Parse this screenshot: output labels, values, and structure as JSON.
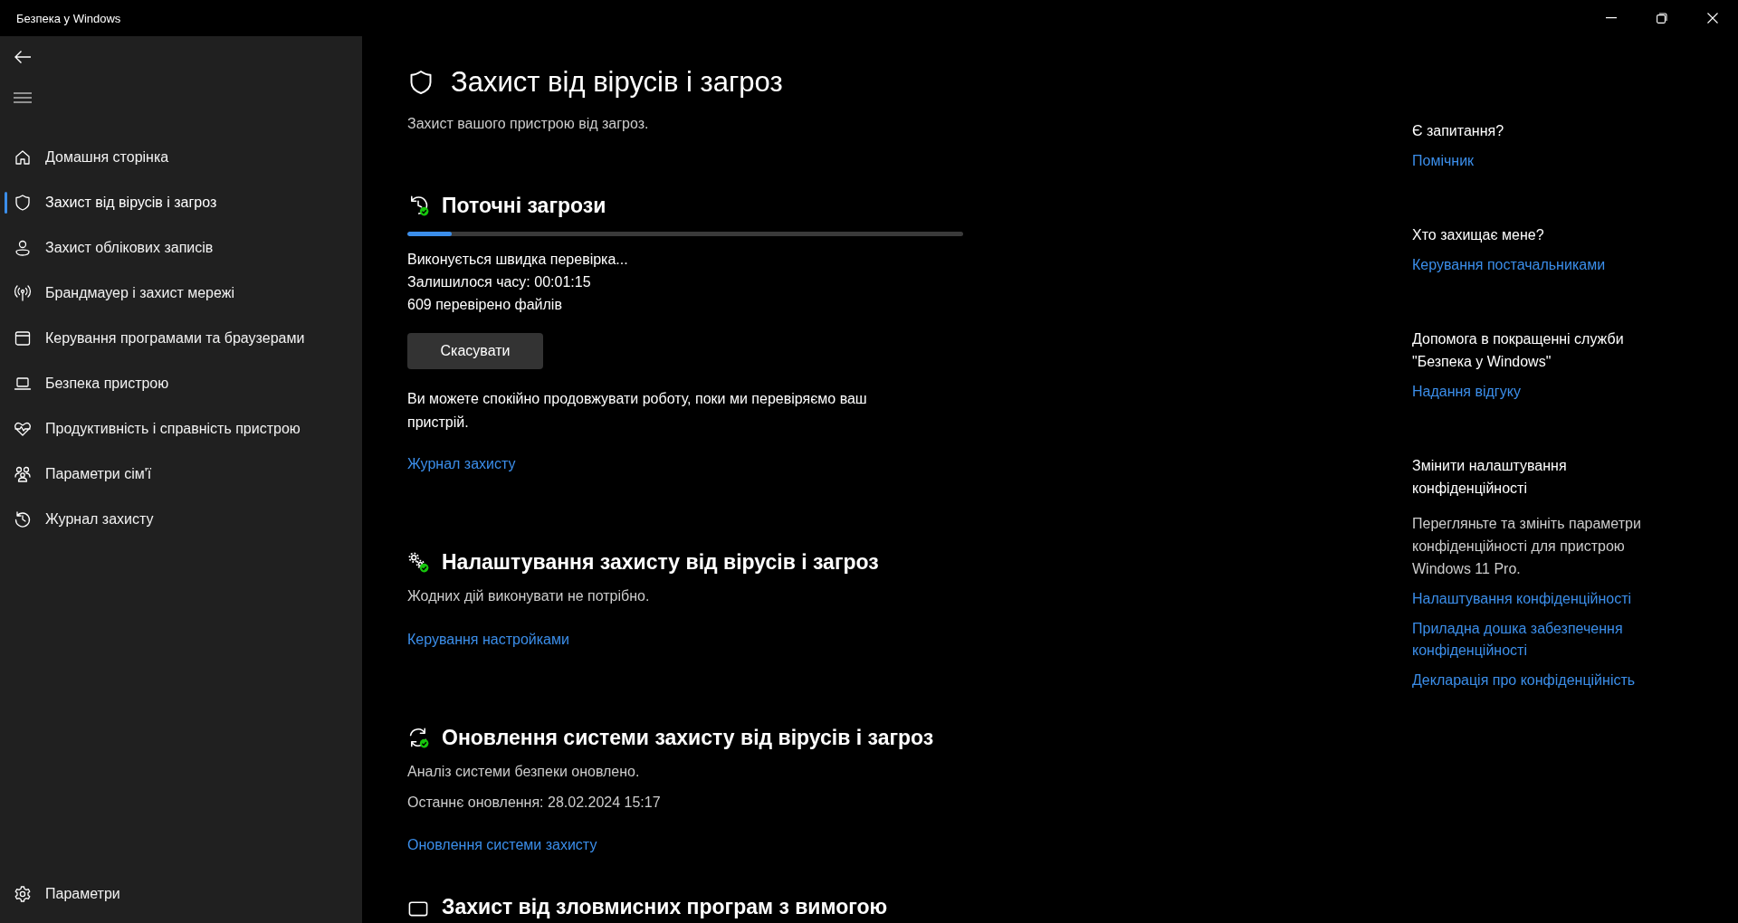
{
  "window": {
    "title": "Безпека у Windows"
  },
  "sidebar": {
    "items": [
      {
        "label": "Домашня сторінка",
        "selected": false
      },
      {
        "label": "Захист від вірусів і загроз",
        "selected": true
      },
      {
        "label": "Захист облікових записів",
        "selected": false
      },
      {
        "label": "Брандмауер і захист мережі",
        "selected": false
      },
      {
        "label": "Керування програмами та браузерами",
        "selected": false
      },
      {
        "label": "Безпека пристрою",
        "selected": false
      },
      {
        "label": "Продуктивність і справність пристрою",
        "selected": false
      },
      {
        "label": "Параметри сім'ї",
        "selected": false
      },
      {
        "label": "Журнал захисту",
        "selected": false
      }
    ],
    "settings": {
      "label": "Параметри"
    }
  },
  "page": {
    "title": "Захист від вірусів і загроз",
    "subtitle": "Захист вашого пристрою від загроз."
  },
  "sections": [
    {
      "kind": "scan",
      "title": "Поточні загрози",
      "progress": {
        "level": 0.08
      },
      "status_lines": [
        "Виконується швидка перевірка...",
        "Залишилося часу: 00:01:15",
        "609 перевірено файлів"
      ],
      "button": "Скасувати",
      "note": "Ви можете спокійно продовжувати роботу, поки ми перевіряємо ваш пристрій.",
      "link": "Журнал захисту"
    },
    {
      "kind": "settings",
      "title": "Налаштування захисту від вірусів і загроз",
      "lines": [
        "Жодних дій виконувати не потрібно."
      ],
      "link": "Керування настройками"
    },
    {
      "kind": "updates",
      "title": "Оновлення системи захисту від вірусів і загроз",
      "lines": [
        "Аналіз системи безпеки оновлено.",
        "Останнє оновлення: 28.02.2024 15:17"
      ],
      "link": "Оновлення системи захисту"
    },
    {
      "kind": "ransomware",
      "title": "Захист від зловмисних програм з вимогою"
    }
  ],
  "aside": [
    {
      "heading": "Є запитання?",
      "links": [
        "Помічник"
      ]
    },
    {
      "heading": "Хто захищає мене?",
      "links": [
        "Керування постачальниками"
      ]
    },
    {
      "heading": "Допомога в покращенні служби \"Безпека у Windows\"",
      "links": [
        "Надання відгуку"
      ]
    },
    {
      "heading": "Змінити налаштування конфіденційності",
      "text": "Перегляньте та змініть параметри конфіденційності для пристрою Windows 11 Pro.",
      "links": [
        "Налаштування конфіденційності",
        "Приладна дошка забезпечення конфіденційності",
        "Декларація про конфіденційність"
      ]
    }
  ]
}
